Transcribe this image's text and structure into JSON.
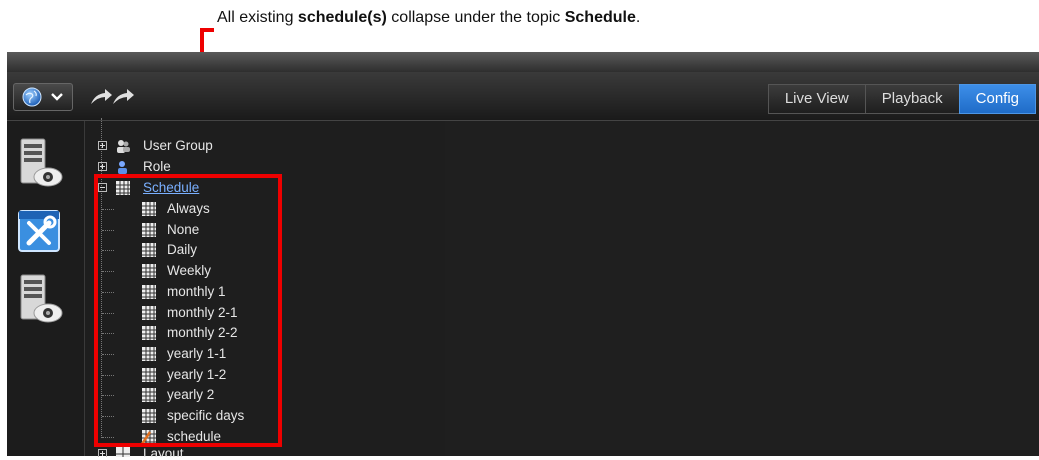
{
  "caption": {
    "pre": "All existing ",
    "bold1": "schedule(s)",
    "mid": " collapse under the topic ",
    "bold2": "Schedule",
    "post": "."
  },
  "nav_tabs": [
    {
      "label": "Live View",
      "active": false
    },
    {
      "label": "Playback",
      "active": false
    },
    {
      "label": "Config",
      "active": true
    }
  ],
  "tree": {
    "user_group": "User Group",
    "role": "Role",
    "schedule": "Schedule",
    "children": [
      "Always",
      "None",
      "Daily",
      "Weekly",
      "monthly 1",
      "monthly 2-1",
      "monthly 2-2",
      "yearly 1-1",
      "yearly 1-2",
      "yearly 2",
      "specific days",
      "schedule"
    ],
    "layout": "Layout"
  },
  "colors": {
    "accent": "#2f7fe0",
    "callout": "#ee0000",
    "background": "#1c1c1c"
  },
  "icons": {
    "left": [
      "server-camera-icon",
      "config-tools-icon",
      "server-camera-icon"
    ]
  }
}
